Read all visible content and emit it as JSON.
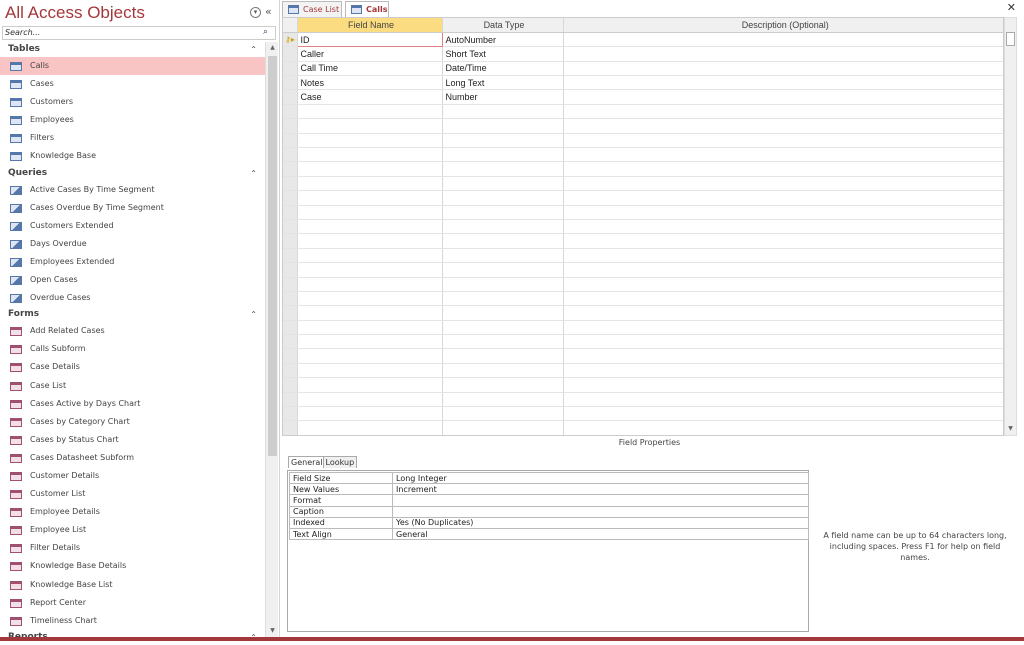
{
  "nav": {
    "title": "All Access Objects",
    "search_placeholder": "Search...",
    "groups": [
      {
        "label": "Tables",
        "kind": "t",
        "items": [
          "Calls",
          "Cases",
          "Customers",
          "Employees",
          "Filters",
          "Knowledge Base"
        ]
      },
      {
        "label": "Queries",
        "kind": "q",
        "items": [
          "Active Cases By Time Segment",
          "Cases Overdue By Time Segment",
          "Customers Extended",
          "Days Overdue",
          "Employees Extended",
          "Open Cases",
          "Overdue Cases"
        ]
      },
      {
        "label": "Forms",
        "kind": "f",
        "items": [
          "Add Related Cases",
          "Calls Subform",
          "Case Details",
          "Case List",
          "Cases Active by Days Chart",
          "Cases by Category Chart",
          "Cases by Status Chart",
          "Cases Datasheet Subform",
          "Customer Details",
          "Customer List",
          "Employee Details",
          "Employee List",
          "Filter Details",
          "Knowledge Base Details",
          "Knowledge Base List",
          "Report Center",
          "Timeliness Chart"
        ]
      },
      {
        "label": "Reports",
        "kind": "r",
        "items": []
      }
    ],
    "selected": "Calls"
  },
  "tabs": [
    {
      "label": "Case List",
      "active": false
    },
    {
      "label": "Calls",
      "active": true
    }
  ],
  "grid": {
    "headers": [
      "Field Name",
      "Data Type",
      "Description (Optional)"
    ],
    "rows": [
      [
        "ID",
        "AutoNumber",
        ""
      ],
      [
        "Caller",
        "Short Text",
        ""
      ],
      [
        "Call Time",
        "Date/Time",
        ""
      ],
      [
        "Notes",
        "Long Text",
        ""
      ],
      [
        "Case",
        "Number",
        ""
      ]
    ]
  },
  "field_properties": {
    "title": "Field Properties",
    "tabs": [
      "General",
      "Lookup"
    ],
    "rows": [
      [
        "Field Size",
        "Long Integer"
      ],
      [
        "New Values",
        "Increment"
      ],
      [
        "Format",
        ""
      ],
      [
        "Caption",
        ""
      ],
      [
        "Indexed",
        "Yes (No Duplicates)"
      ],
      [
        "Text Align",
        "General"
      ]
    ],
    "hint": "A field name can be up to 64 characters long, including spaces. Press F1 for help on field names."
  },
  "colors": {
    "accent": "#a4373a",
    "selected": "#f8c4c4",
    "header_active": "#fcdc80"
  }
}
